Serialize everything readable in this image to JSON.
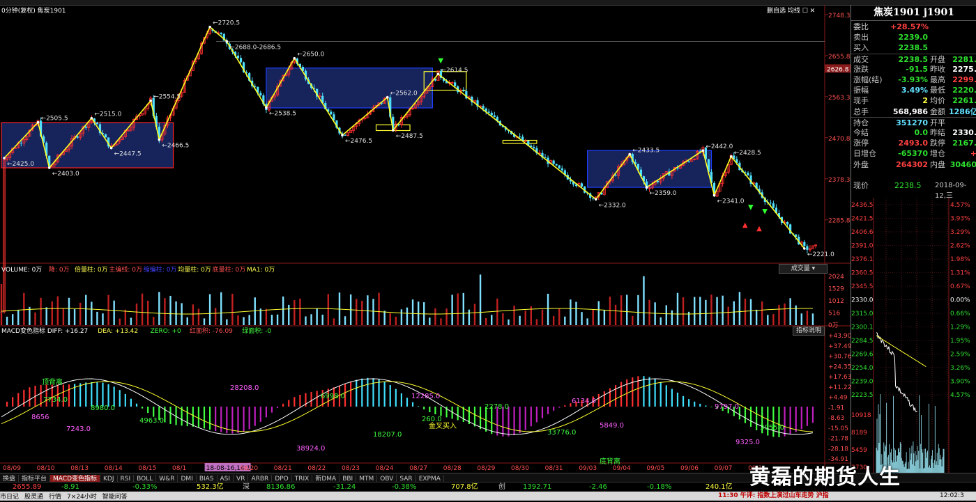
{
  "header": {
    "chart_title": "焦炭1901",
    "period_label": "0分钟(复权)",
    "right_tools": "删自选 均线 ",
    "volume_tool": "成交量",
    "macd_tool": "指标说明"
  },
  "quote": {
    "title": "焦炭1901 j1901",
    "rows": [
      {
        "l": "委比",
        "v": "+28.57%",
        "vc": "red"
      },
      {
        "l": "卖出",
        "v": "2239.0",
        "vc": "green"
      },
      {
        "l": "买入",
        "v": "2238.5",
        "vc": "green"
      },
      {
        "l": "成交",
        "v": "2238.5",
        "vc": "green",
        "l2": "开盘",
        "v2": "2281.",
        "v2c": "green"
      },
      {
        "l": "涨跌",
        "v": "-91.5",
        "vc": "green",
        "l2": "昨收",
        "v2": "2275.",
        "v2c": "white"
      },
      {
        "l": "涨幅(结)",
        "v": "-3.93%",
        "vc": "green",
        "l2": "最高",
        "v2": "2299.",
        "v2c": "red"
      },
      {
        "l": "振幅",
        "v": "3.49%",
        "vc": "cyan",
        "l2": "最低",
        "v2": "2220.",
        "v2c": "green"
      },
      {
        "l": "现手",
        "v": "2",
        "vc": "yellow",
        "l2": "均价",
        "v2": "2261.",
        "v2c": "green"
      },
      {
        "l": "总手",
        "v": "568,986",
        "vc": "white",
        "l2": "金额",
        "v2": "1286亿",
        "v2c": "cyan"
      },
      {
        "l": "持仓",
        "v": "351270",
        "vc": "cyan",
        "l2": "开平",
        "v2": "",
        "v2c": "white"
      },
      {
        "l": "今结",
        "v": "0.0",
        "vc": "green",
        "l2": "昨结",
        "v2": "2330.",
        "v2c": "white"
      },
      {
        "l": "涨停",
        "v": "2493.0",
        "vc": "red",
        "l2": "跌停",
        "v2": "2167.",
        "v2c": "green"
      },
      {
        "l": "日增仓",
        "v": "-65370",
        "vc": "green",
        "l2": "增仓",
        "v2": "+",
        "v2c": "red"
      },
      {
        "l": "外盘",
        "v": "264302",
        "vc": "red",
        "l2": "内盘",
        "v2": "30460",
        "v2c": "green"
      }
    ],
    "now_label": "现价",
    "now_value": "2238.5",
    "date": "2018-09-12,三"
  },
  "mini": {
    "ticks": [
      "2436.5",
      "2421.5",
      "2406.6",
      "2391.0",
      "2376.1",
      "2360.5",
      "2345.5",
      "2330.0",
      "2315.0",
      "2300.1",
      "2284.5",
      "2269.6",
      "2254.0",
      "2239.0",
      "2223.5"
    ],
    "pct": [
      "4.57%",
      "3.93%",
      "3.29%",
      "2.62%",
      "1.98%",
      "1.31%",
      "0.67%",
      "0.00%",
      "0.66%",
      "1.29%",
      "1.95%",
      "2.59%",
      "3.26%",
      "3.90%",
      "4.57%"
    ],
    "vol_ticks": [
      "10918",
      "8189",
      "5459",
      "2730"
    ]
  },
  "volume": {
    "legend": [
      {
        "t": "VOLUME: 0万",
        "c": "#ffffff"
      },
      {
        "t": "降: 0万",
        "c": "#ff5050"
      },
      {
        "t": "倍量柱: 0万",
        "c": "#ffff50"
      },
      {
        "t": "主编线: 0万",
        "c": "#ff5050"
      },
      {
        "t": "缩编柱: 0万",
        "c": "#4040ff"
      },
      {
        "t": "均量柱: 0万",
        "c": "#ffff50"
      },
      {
        "t": "底量柱: 0万",
        "c": "#ff5050"
      },
      {
        "t": "MA1: 0万",
        "c": "#ffff50"
      }
    ],
    "axis": [
      "2024",
      "1529",
      "1012",
      "516",
      "0万"
    ]
  },
  "macd": {
    "legend": [
      {
        "t": "MACD变色指标 DIFF: +16.27",
        "c": "#ffffff"
      },
      {
        "t": "DEA: +13.42",
        "c": "#ffff50"
      },
      {
        "t": "ZERO: +0",
        "c": "#40ff40"
      },
      {
        "t": "红面积: -76.09",
        "c": "#ff5050"
      },
      {
        "t": "绿面积: -0",
        "c": "#40ff40"
      }
    ],
    "axis": [
      "+43.90",
      "+37.49",
      "+30.76",
      "+24.35",
      "+17.63",
      "+11.22",
      "+4.49",
      "-1.91",
      "-8.63",
      "-15.05",
      "-21.78",
      "-28.18",
      "-34.91"
    ],
    "labels": [
      "顶背离",
      "7734.0",
      "8656",
      "8980.0",
      "7243.0",
      "4963.0",
      "28208.0",
      "6998.0",
      "38924.0",
      "18207.0",
      "12285.0",
      "260.0",
      "金叉买入",
      "2278.0",
      "6134.0",
      "33776.0",
      "5849.0",
      "底背离",
      "9797.0",
      "3055.0",
      "9325.0"
    ]
  },
  "xaxis": [
    "08/09",
    "08/10",
    "08/13",
    "08/14",
    "08/15",
    "08/1",
    "18-08-16,14:15",
    "08/20",
    "08/21",
    "08/22",
    "08/23",
    "08/24",
    "08/27",
    "08/28",
    "08/29",
    "08/30",
    "08/31",
    "09/03",
    "09/04",
    "09/05",
    "09/06",
    "09/07",
    "09/1"
  ],
  "tabs": [
    "换盘",
    "指标平台",
    "MACD变色指标",
    "KDJ",
    "RSI",
    "BOLL",
    "W&R",
    "DMI",
    "BIAS",
    "ASI",
    "VR",
    "ARBR",
    "DPO",
    "TRIX",
    "新DMA",
    "BBI",
    "MTM",
    "OBV",
    "SAR",
    "EXPMA"
  ],
  "index_bar": {
    "v1": "2655.89",
    "v2": "-8.91",
    "v3": "-0.33%",
    "v4": "532.3亿",
    "lab": "深",
    "v5": "8136.86",
    "v6": "-31.24",
    "v7": "-0.38%",
    "v8": "707.8亿",
    "lab2": "创",
    "v9": "1392.71",
    "v10": "-2.46",
    "v11": "-0.18%",
    "v12": "240.1亿"
  },
  "status": {
    "items": [
      "市日记",
      "股灵通",
      "行情",
      "7×24小时",
      "智能问答"
    ],
    "news": "11:30 午评: 指数上演过山车走势 沪指",
    "right": "12:02:3"
  },
  "watermark": "黄磊的期货人生",
  "chart_data": {
    "type": "candlestick",
    "title": "焦炭1901",
    "ylim": [
      2221.0,
      2748.3
    ],
    "yticks": [
      2748.3,
      2655.8,
      2563.3,
      2470.8,
      2378.3,
      2285.8
    ],
    "highlighted_price": "2626.8",
    "wave_points": [
      {
        "label": "2425.0",
        "value": 2425.0
      },
      {
        "label": "2505.5",
        "value": 2505.5
      },
      {
        "label": "2403.0",
        "value": 2403.0
      },
      {
        "label": "2515.0",
        "value": 2515.0
      },
      {
        "label": "2447.5",
        "value": 2447.5
      },
      {
        "label": "2554.5",
        "value": 2554.5
      },
      {
        "label": "2466.5",
        "value": 2466.5
      },
      {
        "label": "2720.5",
        "value": 2720.5
      },
      {
        "label": "2688.0-2686.5",
        "value": 2688.0
      },
      {
        "label": "2538.5",
        "value": 2538.5
      },
      {
        "label": "2650.0",
        "value": 2650.0
      },
      {
        "label": "2476.5",
        "value": 2476.5
      },
      {
        "label": "2562.0",
        "value": 2562.0
      },
      {
        "label": "2487.5",
        "value": 2487.5
      },
      {
        "label": "2614.5",
        "value": 2614.5
      },
      {
        "label": "2332.0",
        "value": 2332.0
      },
      {
        "label": "2433.5",
        "value": 2433.5
      },
      {
        "label": "2359.0",
        "value": 2359.0
      },
      {
        "label": "2442.0",
        "value": 2442.0
      },
      {
        "label": "2341.0",
        "value": 2341.0
      },
      {
        "label": "2428.5",
        "value": 2428.5
      },
      {
        "label": "2221.0",
        "value": 2221.0
      }
    ],
    "wave_x_index": [
      1,
      13,
      17,
      32,
      39,
      53,
      56,
      74,
      80,
      94,
      104,
      121,
      137,
      139,
      155,
      211,
      223,
      229,
      249,
      253,
      259,
      285
    ]
  }
}
